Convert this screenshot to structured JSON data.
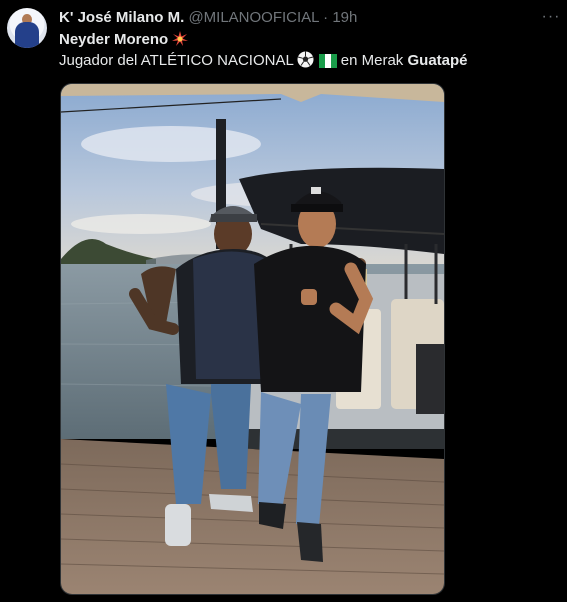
{
  "tweet": {
    "author_name": "K' José Milano M.",
    "handle": "@MILANOOFICIAL",
    "separator": "·",
    "time": "19h",
    "text_line1": "Neyder Moreno",
    "text_line2_start": "Jugador del ATLÉTICO NACIONAL",
    "text_line2_mid": "en Merak",
    "text_line2_end": "Guatapé",
    "icons": [
      "avatar-photo",
      "sparkle-emoji",
      "soccer-ball-emoji",
      "nigeria-flag-emoji",
      "more-options-icon"
    ]
  },
  "photo": {
    "description_colors": {
      "sky": "#9db8d8",
      "lake": "#6f7f88",
      "dock": "#8a7462",
      "boat_roof": "#1b1d22"
    }
  }
}
